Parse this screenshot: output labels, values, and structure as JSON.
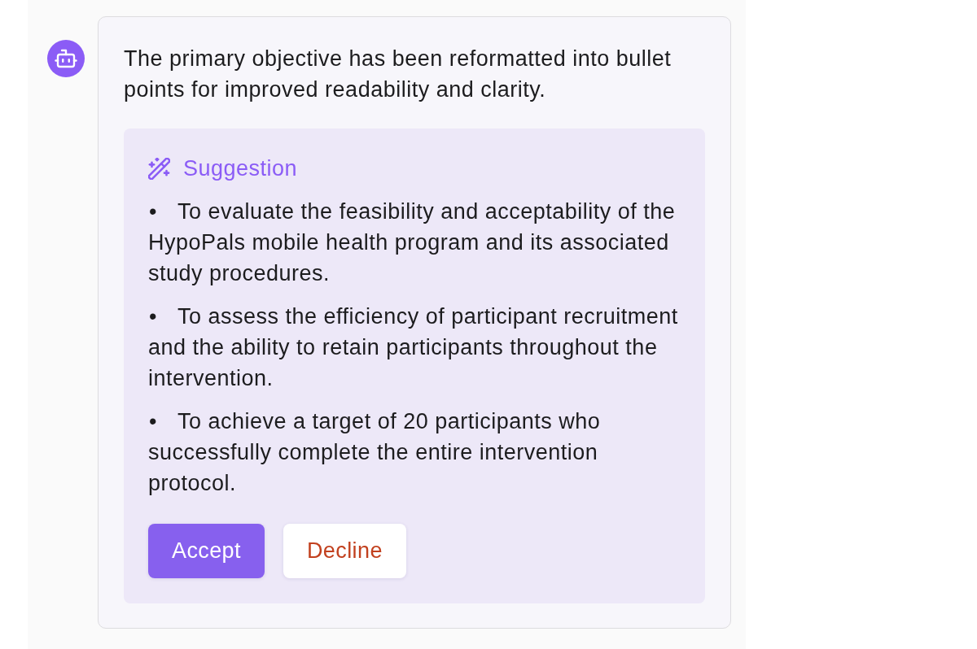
{
  "message": {
    "text": "The primary objective has been reformatted into bullet points for improved readability and clarity.",
    "suggestion": {
      "title": "Suggestion",
      "items": [
        {
          "marker": "•",
          "text": "To evaluate the feasibility and acceptability of the HypoPals mobile health program and its associated study procedures."
        },
        {
          "marker": "•",
          "text": "To assess the efficiency of participant recruitment and the ability to retain participants throughout the intervention."
        },
        {
          "marker": "•",
          "text": "To achieve a target of 20 participants who successfully complete the entire intervention protocol."
        }
      ],
      "buttons": [
        {
          "label": "Accept",
          "kind": "primary"
        },
        {
          "label": "Decline",
          "kind": "secondary"
        }
      ]
    }
  }
}
